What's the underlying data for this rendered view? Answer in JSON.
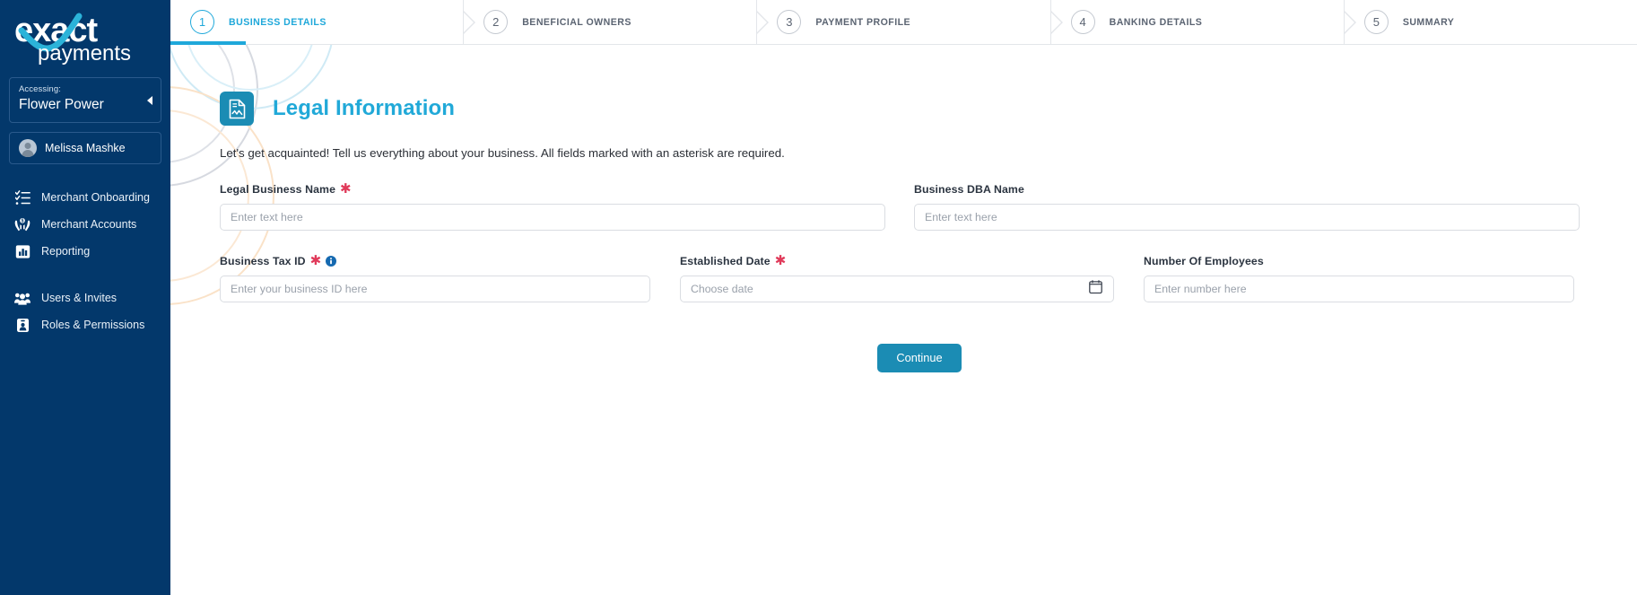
{
  "brand": {
    "name": "exact",
    "subname": "payments",
    "sidebar_bg": "#03386b",
    "accent_cyan": "#21a9d8",
    "accent_teal": "#1b8cb4",
    "required_red": "#e03a5a"
  },
  "sidebar": {
    "accessing_label": "Accessing:",
    "org_name": "Flower Power",
    "user_name": "Melissa Mashke",
    "nav_groups": [
      {
        "items": [
          {
            "label": "Merchant Onboarding",
            "icon": "checklist-icon"
          },
          {
            "label": "Merchant Accounts",
            "icon": "hands-money-icon"
          },
          {
            "label": "Reporting",
            "icon": "bar-chart-icon"
          }
        ]
      },
      {
        "items": [
          {
            "label": "Users & Invites",
            "icon": "users-icon"
          },
          {
            "label": "Roles & Permissions",
            "icon": "id-badge-icon"
          }
        ]
      }
    ]
  },
  "stepper": {
    "steps": [
      {
        "number": "1",
        "label": "BUSINESS DETAILS",
        "active": true
      },
      {
        "number": "2",
        "label": "BENEFICIAL OWNERS",
        "active": false
      },
      {
        "number": "3",
        "label": "PAYMENT PROFILE",
        "active": false
      },
      {
        "number": "4",
        "label": "BANKING DETAILS",
        "active": false
      },
      {
        "number": "5",
        "label": "SUMMARY",
        "active": false
      }
    ]
  },
  "page": {
    "title": "Legal Information",
    "icon": "document-legal-icon",
    "subtitle": "Let's get acquainted! Tell us everything about your business. All fields marked with an asterisk are required."
  },
  "form": {
    "fields": {
      "legal_business_name": {
        "label": "Legal Business Name",
        "required": true,
        "value": "",
        "placeholder": "Enter text here"
      },
      "business_dba_name": {
        "label": "Business DBA Name",
        "required": false,
        "value": "",
        "placeholder": "Enter text here"
      },
      "business_tax_id": {
        "label": "Business Tax ID",
        "required": true,
        "has_info": true,
        "value": "",
        "placeholder": "Enter your business ID here"
      },
      "established_date": {
        "label": "Established Date",
        "required": true,
        "value": "",
        "placeholder": "Choose date",
        "icon": "calendar-icon"
      },
      "number_of_employees": {
        "label": "Number Of Employees",
        "required": false,
        "value": "",
        "placeholder": "Enter number here"
      }
    },
    "continue_label": "Continue"
  }
}
